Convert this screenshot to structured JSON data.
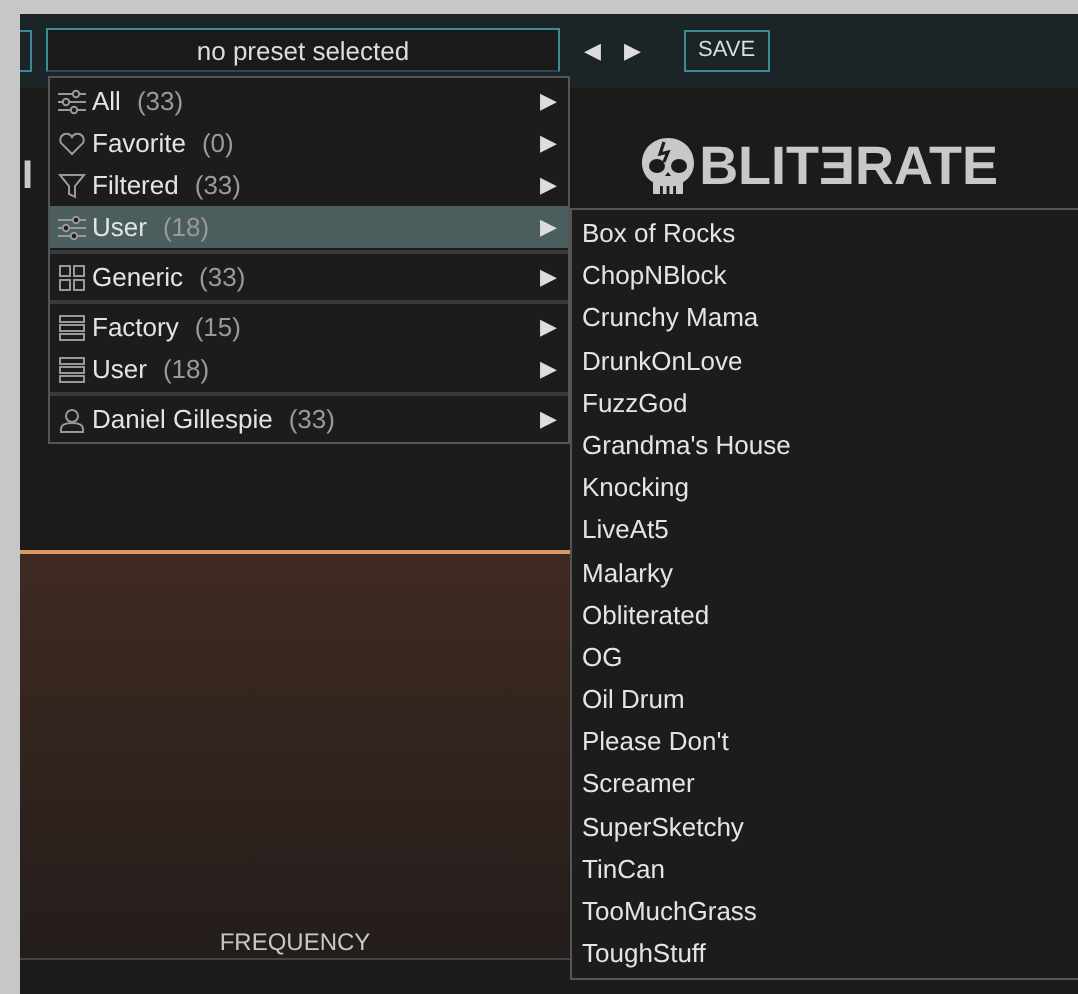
{
  "preset_field": {
    "value": "no preset selected"
  },
  "nav": {
    "previous": "◀",
    "next": "▶"
  },
  "save_button": "SAVE",
  "partial_label": "I",
  "logo": "BLITƎRATE",
  "menu": {
    "groups": [
      {
        "items": [
          {
            "kind": "sliders",
            "label": "All",
            "count": "(33)",
            "arrow": "▶",
            "selected": false
          },
          {
            "kind": "heart",
            "label": "Favorite",
            "count": "(0)",
            "arrow": "▶",
            "selected": false
          },
          {
            "kind": "filter",
            "label": "Filtered",
            "count": "(33)",
            "arrow": "▶",
            "selected": false
          },
          {
            "kind": "sliders",
            "label": "User",
            "count": "(18)",
            "arrow": "▶",
            "selected": true
          }
        ]
      },
      {
        "items": [
          {
            "kind": "grid",
            "label": "Generic",
            "count": "(33)",
            "arrow": "▶",
            "selected": false
          }
        ]
      },
      {
        "items": [
          {
            "kind": "list",
            "label": "Factory",
            "count": "(15)",
            "arrow": "▶",
            "selected": false
          },
          {
            "kind": "list",
            "label": "User",
            "count": "(18)",
            "arrow": "▶",
            "selected": false
          }
        ]
      },
      {
        "items": [
          {
            "kind": "person",
            "label": "Daniel Gillespie",
            "count": "(33)",
            "arrow": "▶",
            "selected": false
          }
        ]
      }
    ]
  },
  "submenu": {
    "items": [
      "Box of Rocks",
      "ChopNBlock",
      "Crunchy Mama",
      "DrunkOnLove",
      "FuzzGod",
      "Grandma's House",
      "Knocking",
      "LiveAt5",
      "Malarky",
      "Obliterated",
      "OG",
      "Oil Drum",
      "Please Don't",
      "Screamer",
      "SuperSketchy",
      "TinCan",
      "TooMuchGrass",
      "ToughStuff"
    ]
  },
  "graph": {
    "axis_label": "FREQUENCY"
  }
}
